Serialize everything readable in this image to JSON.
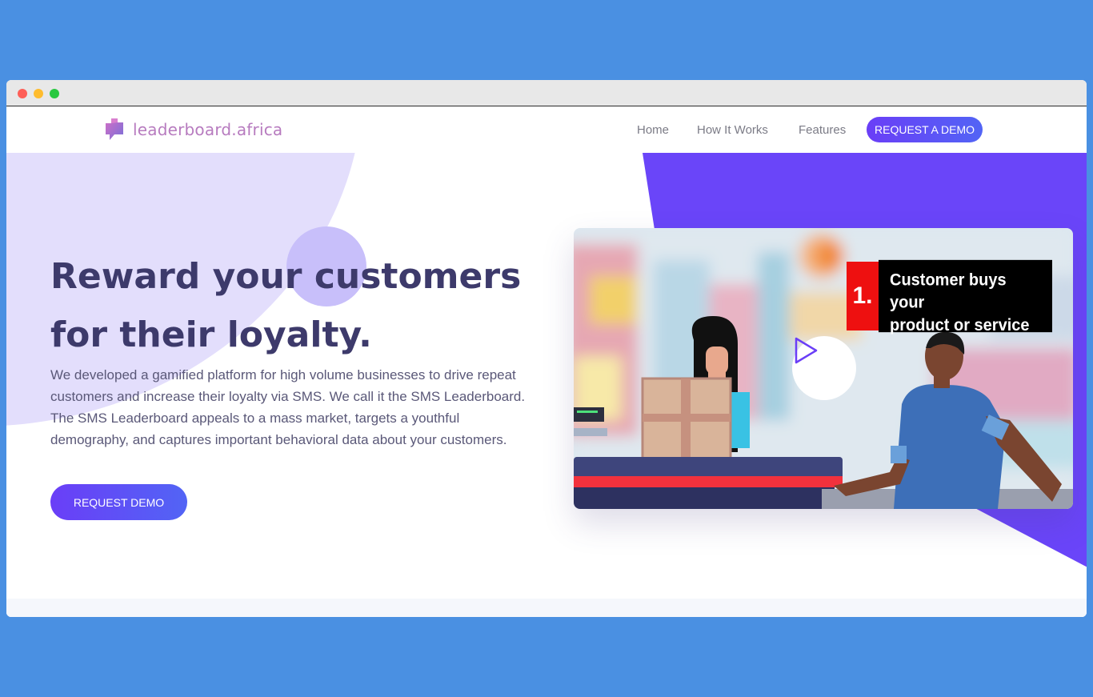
{
  "window": {
    "controls": [
      "close",
      "minimize",
      "maximize"
    ]
  },
  "nav": {
    "logo_text": "leaderboard.africa",
    "logo_icon": "chat-bubble-logo-icon",
    "links": [
      {
        "label": "Home"
      },
      {
        "label": "How It Works"
      },
      {
        "label": "Features"
      }
    ],
    "cta_label": "REQUEST A DEMO"
  },
  "hero": {
    "headline_line1": "Reward your customers",
    "headline_line2": "for their loyalty.",
    "description": "We developed a gamified platform for high volume businesses to drive repeat customers and increase their loyalty via SMS. We call it the SMS Leaderboard. The SMS Leaderboard appeals to a mass market, targets a youthful demography, and captures important behavioral data about your customers.",
    "cta_label": "REQUEST DEMO"
  },
  "video": {
    "caption_number": "1.",
    "caption_line1": "Customer buys your",
    "caption_line2": "product or service",
    "play_icon": "play-icon"
  },
  "colors": {
    "accent_purple": "#6a45f9",
    "button_gradient_start": "#6a3ef7",
    "button_gradient_end": "#5264f5",
    "headline": "#3d3a6b",
    "logo": "#b77bbf",
    "background": "#4a90e2"
  }
}
